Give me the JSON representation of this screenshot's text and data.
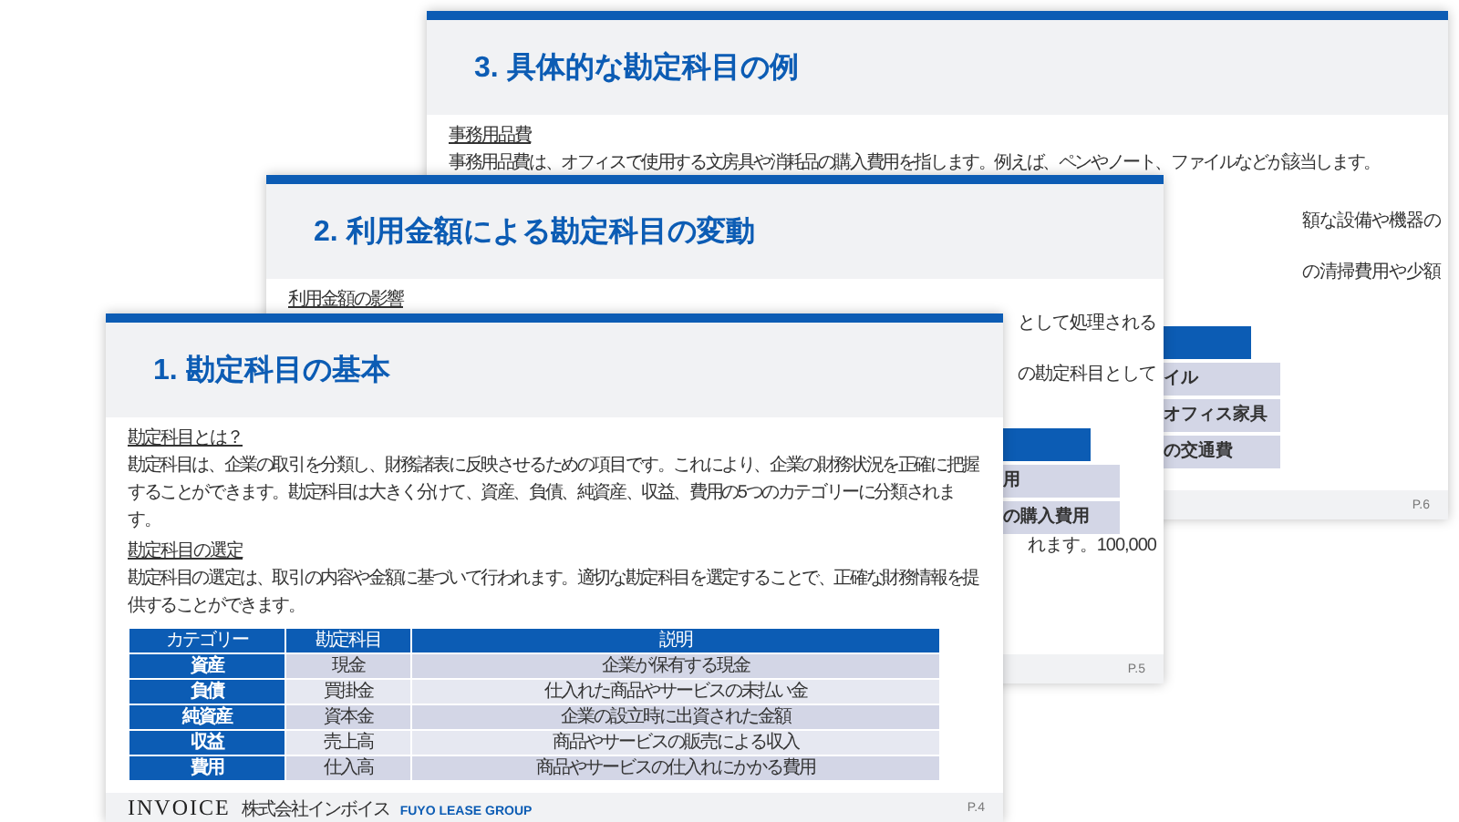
{
  "pages": [
    {
      "title": "3. 具体的な勘定科目の例",
      "sections": [
        {
          "heading": "事務用品費",
          "paragraphs": [
            "事務用品費は、オフィスで使用する文房具や消耗品の購入費用を指します。例えば、ペンやノート、ファイルなどが該当します。"
          ]
        }
      ],
      "fragments": [
        {
          "kind": "text",
          "text": "額な設備や機器の"
        },
        {
          "kind": "text",
          "text": "の清掃費用や少額"
        },
        {
          "kind": "table-header"
        },
        {
          "kind": "table-row",
          "text": "イル"
        },
        {
          "kind": "table-row",
          "text": "オフィス家具"
        },
        {
          "kind": "table-row",
          "text": "の交通費"
        }
      ],
      "number": "P.6"
    },
    {
      "title": "2. 利用金額による勘定科目の変動",
      "sections": [
        {
          "heading": "利用金額の影響"
        }
      ],
      "fragments": [
        {
          "kind": "text",
          "text": "として処理される"
        },
        {
          "kind": "text",
          "text": "の勘定科目として"
        },
        {
          "kind": "table-header"
        },
        {
          "kind": "table-row",
          "text": "用"
        },
        {
          "kind": "table-row",
          "text": "の購入費用"
        },
        {
          "kind": "text",
          "text": "れます。100,000"
        }
      ],
      "number": "P.5"
    },
    {
      "title": "1. 勘定科目の基本",
      "sections": [
        {
          "heading": "勘定科目とは？",
          "paragraphs": [
            "勘定科目は、企業の取引を分類し、財務諸表に反映させるための項目です。これにより、企業の財務状況を正確に把握することができます。勘定科目は大きく分けて、資産、負債、純資産、収益、費用の5つのカテゴリーに分類されます。"
          ]
        },
        {
          "heading": "勘定科目の選定",
          "paragraphs": [
            "勘定科目の選定は、取引の内容や金額に基づいて行われます。適切な勘定科目を選定することで、正確な財務情報を提供することができます。"
          ]
        }
      ],
      "table": {
        "columns": [
          "カテゴリー",
          "勘定科目",
          "説明"
        ],
        "rows": [
          [
            "資産",
            "現金",
            "企業が保有する現金"
          ],
          [
            "負債",
            "買掛金",
            "仕入れた商品やサービスの未払い金"
          ],
          [
            "純資産",
            "資本金",
            "企業の設立時に出資された金額"
          ],
          [
            "収益",
            "売上高",
            "商品やサービスの販売による収入"
          ],
          [
            "費用",
            "仕入高",
            "商品やサービスの仕入れにかかる費用"
          ]
        ]
      },
      "footer": {
        "brand": "INVOICE",
        "company": "株式会社インボイス",
        "group": "FUYO LEASE GROUP"
      },
      "number": "P.4"
    }
  ]
}
